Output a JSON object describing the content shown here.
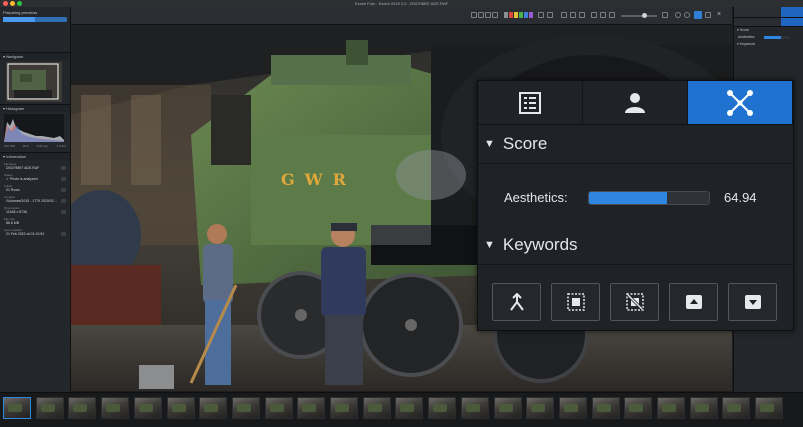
{
  "window": {
    "title": "Excire Foto - Excire 2019 2.0 - DSCF8897 ADE.RAF"
  },
  "left_panel": {
    "progress_label": "Preparing previews",
    "progress_fraction": 0.5,
    "navigator_label": "Navigator",
    "histogram_label": "Histogram",
    "histogram_axis": [
      "ISO 400",
      "f/5.6",
      "0.05 sec",
      "-1.5 EV"
    ],
    "info_label": "Information",
    "info": [
      {
        "label": "Filename",
        "value": "DSCF8897 ADE.RAF"
      },
      {
        "label": "Status",
        "value": "✓ Photo is analyzed"
      },
      {
        "label": "Folder",
        "value": "01 Rows"
      },
      {
        "label": "Location",
        "value": "/Volumes/2015 - 1779 2020/02..."
      },
      {
        "label": "Dimensions",
        "value": "11648 x 8736"
      },
      {
        "label": "File size",
        "value": "86.8 MB"
      },
      {
        "label": "Last modified",
        "value": "21 Feb 2020 at 01:10:54"
      }
    ]
  },
  "right_panel": {
    "score_label": "Score",
    "aesthetics_label": "Aesthetics:",
    "keywords_label": "Keywords"
  },
  "overlay": {
    "score_title": "Score",
    "aesthetics_label": "Aesthetics:",
    "aesthetics_value": "64.94",
    "aesthetics_fraction": 0.6494,
    "keywords_title": "Keywords",
    "tabs": [
      "info-list-icon",
      "person-icon",
      "network-icon"
    ],
    "buttons": [
      "merge-keywords-icon",
      "select-all-icon",
      "deselect-icon",
      "upload-icon",
      "download-icon"
    ]
  },
  "photo": {
    "engine_lettering": "GWR"
  },
  "colors": {
    "accent": "#1f72d0",
    "bar_fill": "#2f86e0"
  }
}
